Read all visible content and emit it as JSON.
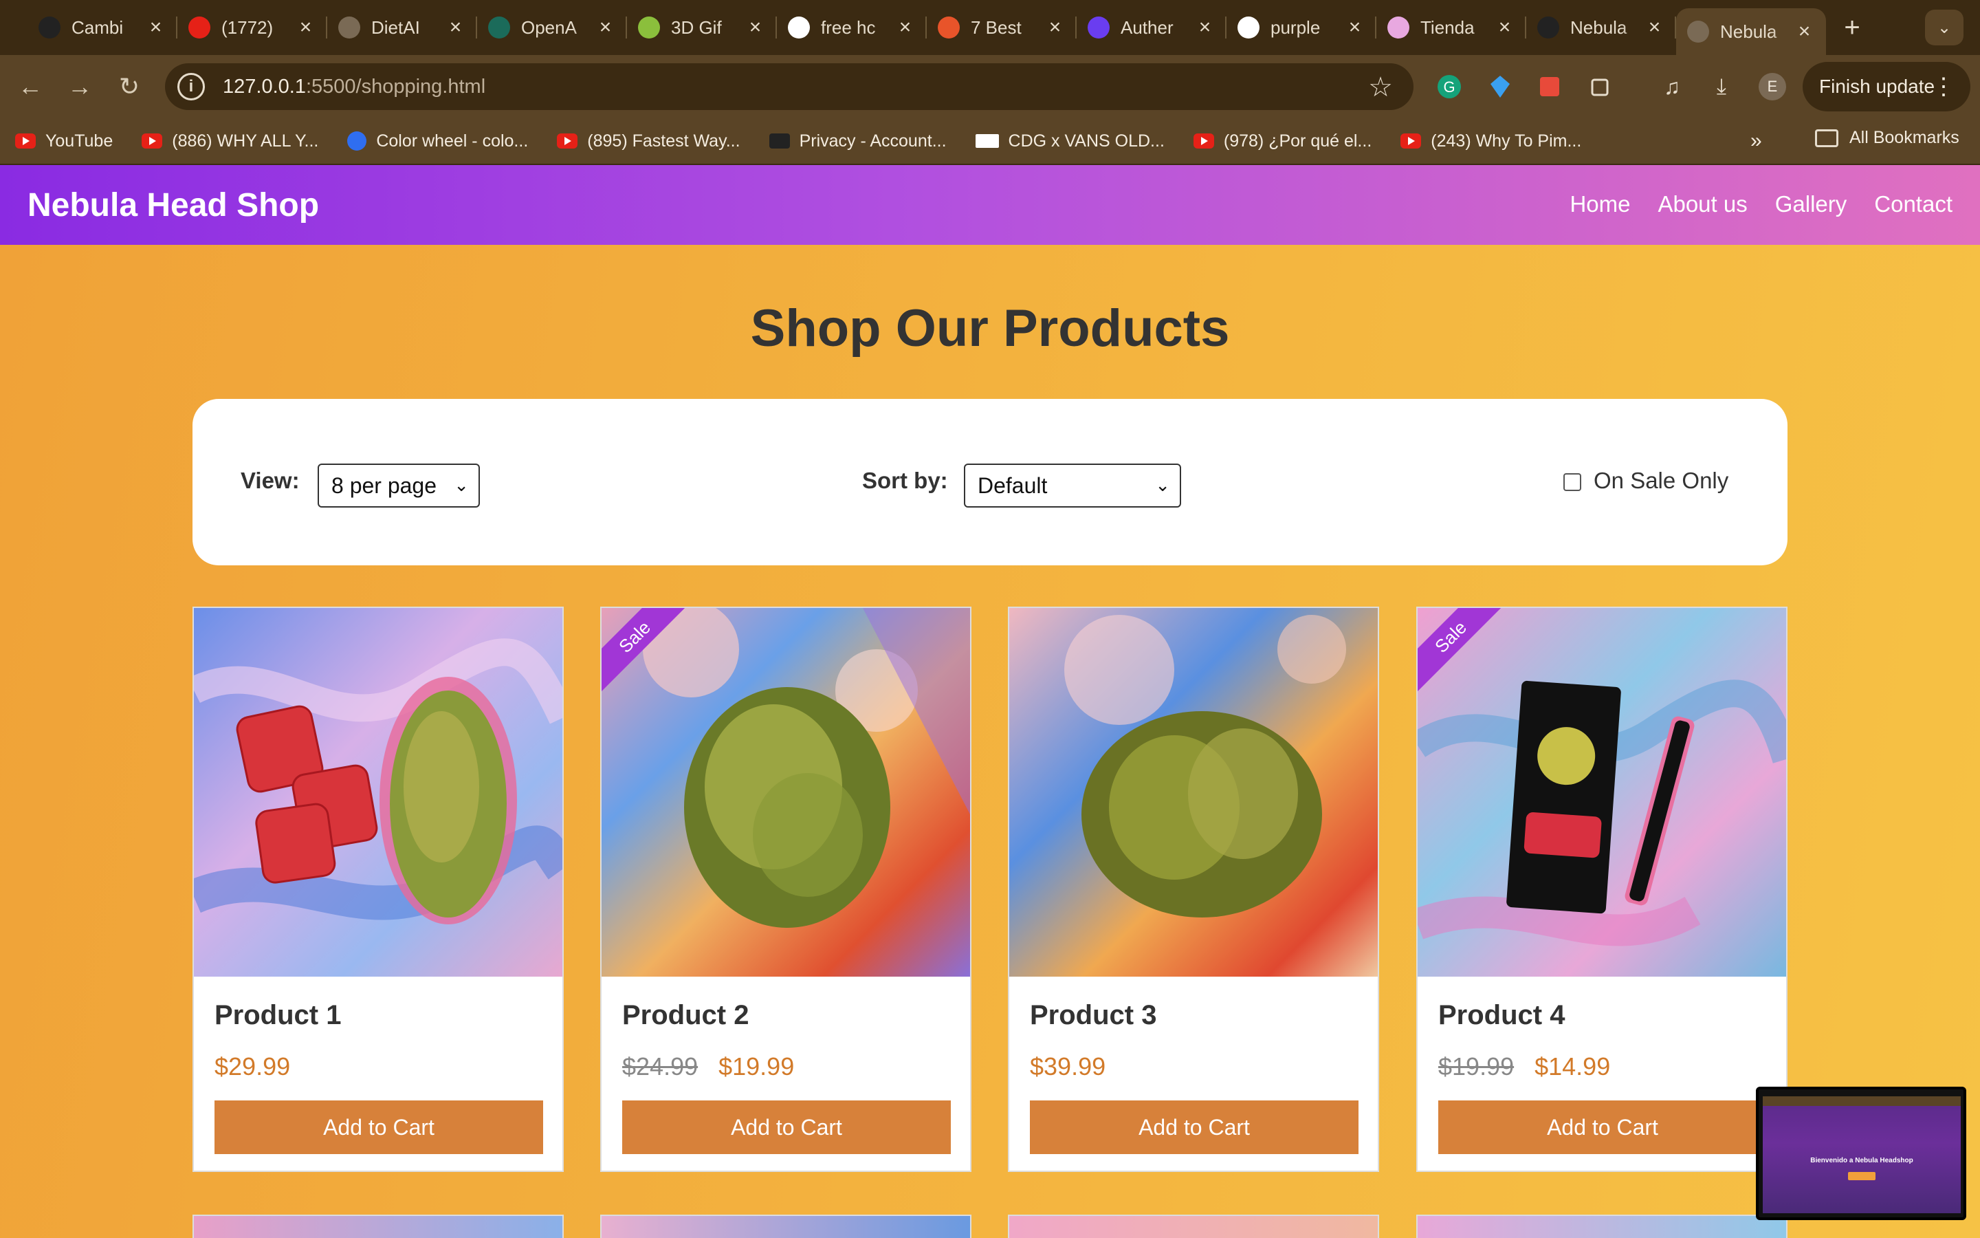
{
  "browser": {
    "tabs": [
      {
        "title": "Cambi",
        "icon": "openai-icon",
        "color": "#222222"
      },
      {
        "title": "(1772)",
        "icon": "youtube-icon",
        "color": "#e62117"
      },
      {
        "title": "DietAI",
        "icon": "globe-icon",
        "color": "#7a6a55"
      },
      {
        "title": "OpenA",
        "icon": "openai-icon",
        "color": "#1b6b5a"
      },
      {
        "title": "3D Gif",
        "icon": "gif-icon",
        "color": "#8bbf3c"
      },
      {
        "title": "free hc",
        "icon": "google-icon",
        "color": "#ffffff"
      },
      {
        "title": "7 Best",
        "icon": "ha-icon",
        "color": "#e8542a"
      },
      {
        "title": "Auther",
        "icon": "auth-icon",
        "color": "#6a3df0"
      },
      {
        "title": "purple",
        "icon": "google-icon",
        "color": "#ffffff"
      },
      {
        "title": "Tienda",
        "icon": "tienda-icon",
        "color": "#e8a8e0"
      },
      {
        "title": "Nebula",
        "icon": "nebula-icon",
        "color": "#222222"
      },
      {
        "title": "Nebula",
        "icon": "globe-icon",
        "color": "#7a6a55",
        "active": true
      }
    ],
    "url_host": "127.0.0.1",
    "url_path": ":5500/shopping.html",
    "finish_update": "Finish update",
    "avatar_letter": "E",
    "bookmarks": [
      {
        "label": "YouTube",
        "icon": "youtube-icon"
      },
      {
        "label": "(886) WHY ALL Y...",
        "icon": "youtube-icon"
      },
      {
        "label": "Color wheel - colo...",
        "icon": "canva-icon"
      },
      {
        "label": "(895) Fastest Way...",
        "icon": "youtube-icon"
      },
      {
        "label": "Privacy - Account...",
        "icon": "p-icon"
      },
      {
        "label": "CDG x VANS OLD...",
        "icon": "cdg-icon"
      },
      {
        "label": "(978) ¿Por qué el...",
        "icon": "youtube-icon"
      },
      {
        "label": "(243) Why To Pim...",
        "icon": "youtube-icon"
      }
    ],
    "all_bookmarks": "All Bookmarks"
  },
  "site": {
    "logo": "Nebula Head Shop",
    "nav": [
      "Home",
      "About us",
      "Gallery",
      "Contact"
    ],
    "page_title": "Shop Our Products",
    "filters": {
      "view_label": "View:",
      "view_value": "8 per page",
      "sort_label": "Sort by:",
      "sort_value": "Default",
      "sale_label": "On Sale Only"
    },
    "add_to_cart": "Add to Cart",
    "sale_badge": "Sale",
    "products": [
      {
        "name": "Product 1",
        "price": "$29.99",
        "old_price": "",
        "sale": false
      },
      {
        "name": "Product 2",
        "price": "$19.99",
        "old_price": "$24.99",
        "sale": true
      },
      {
        "name": "Product 3",
        "price": "$39.99",
        "old_price": "",
        "sale": false
      },
      {
        "name": "Product 4",
        "price": "$14.99",
        "old_price": "$19.99",
        "sale": true
      }
    ],
    "pip_caption": "Bienvenido a Nebula Headshop"
  }
}
